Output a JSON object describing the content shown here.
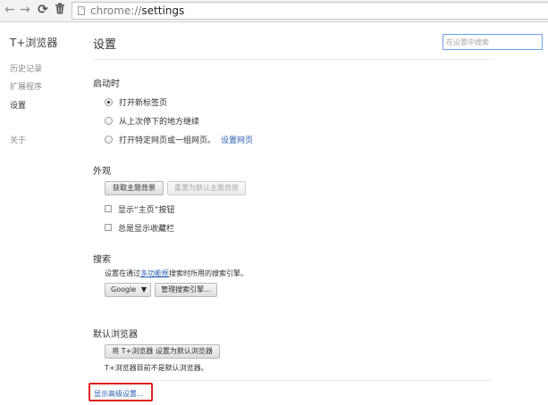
{
  "browser": {
    "url_scheme": "chrome://",
    "url_host": "settings"
  },
  "sidebar": {
    "title": "T+浏览器",
    "items": [
      {
        "label": "历史记录"
      },
      {
        "label": "扩展程序"
      },
      {
        "label": "设置",
        "selected": true
      },
      {
        "label": "关于"
      }
    ]
  },
  "header": {
    "title": "设置",
    "search_placeholder": "在设置中搜索"
  },
  "startup": {
    "title": "启动时",
    "options": [
      {
        "label": "打开新标签页",
        "selected": true
      },
      {
        "label": "从上次停下的地方继续",
        "selected": false
      },
      {
        "label": "打开特定网页或一组网页。",
        "selected": false,
        "link": "设置网页"
      }
    ]
  },
  "appearance": {
    "title": "外观",
    "get_theme_label": "获取主题背景",
    "reset_theme_label": "重置为默认主题背景",
    "show_home_label": "显示“主页”按钮",
    "show_bookmarks_label": "总是显示收藏栏",
    "show_home_checked": false,
    "show_bookmarks_checked": false
  },
  "search": {
    "title": "搜索",
    "desc_before": "设置在通过",
    "desc_link": "多功能框",
    "desc_after": "搜索时所用的搜索引擎。",
    "engine_value": "Google",
    "manage_label": "管理搜索引擎..."
  },
  "default_browser": {
    "title": "默认浏览器",
    "set_default_label": "将 T+浏览器 设置为默认浏览器",
    "status_text": "T+浏览器目前不是默认浏览器。"
  },
  "advanced": {
    "link_label": "显示高级设置...",
    "highlight_color": "#e02020"
  },
  "colors": {
    "link": "#2a5db0",
    "search_border": "#6fa0e8"
  }
}
